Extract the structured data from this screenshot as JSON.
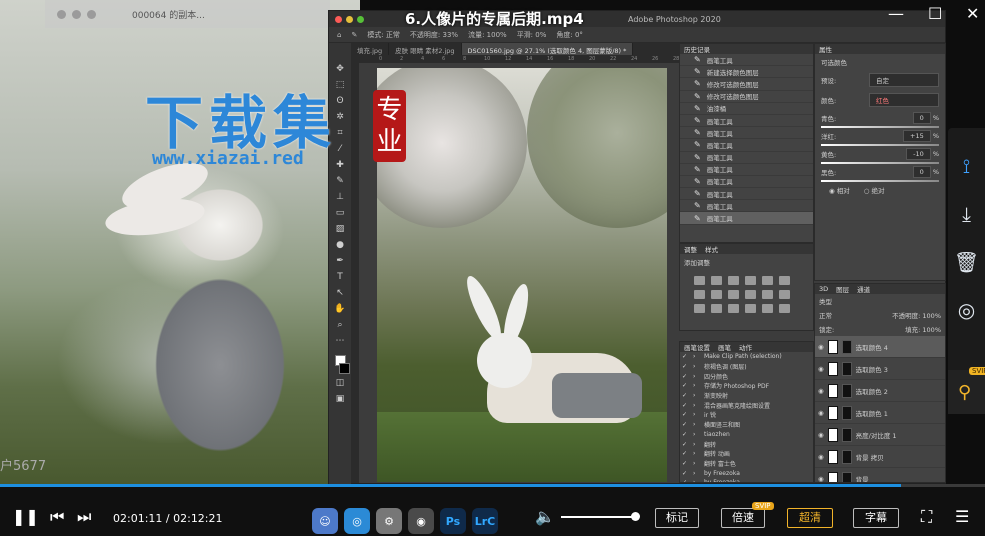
{
  "player": {
    "title": "6.人像片的专属后期.mp4",
    "current_time": "02:01:11",
    "total_time": "02:12:21",
    "time_sep": " / ",
    "progress": 0.915,
    "buttons": {
      "mark": "标记",
      "speed": "倍速",
      "quality": "超清",
      "subtitle": "字幕",
      "svip": "SVIP"
    },
    "top_controls": {
      "minimize": "—",
      "maximize": "☐",
      "close": "✕"
    }
  },
  "background_window": {
    "file_name": "000064 的副本..."
  },
  "watermark": {
    "title": "下载集",
    "url": "www.xiazai.red",
    "seal": [
      "专",
      "业"
    ]
  },
  "side_text": "户5677",
  "photoshop": {
    "app_title": "Adobe Photoshop 2020",
    "options_bar": [
      "模式: 正常",
      "不透明度: 33%",
      "流量: 100%",
      "平滑: 0%",
      "角度: 0°"
    ],
    "tabs": [
      "填充.jpg",
      "皮肤 眼睛 素材2.jpg",
      "DSC01560.jpg @ 27.1% (选取颜色 4, 图层蒙版/8) *"
    ],
    "active_tab": 2,
    "ruler_ticks": [
      "0",
      "2",
      "4",
      "6",
      "8",
      "10",
      "12",
      "14",
      "16",
      "18",
      "20",
      "22",
      "24",
      "26",
      "28"
    ],
    "history": {
      "tabs": [
        "历史记录"
      ],
      "items": [
        "画笔工具",
        "新建选择颜色图层",
        "修改可选颜色图层",
        "修改可选颜色图层",
        "油漆桶",
        "画笔工具",
        "画笔工具",
        "画笔工具",
        "画笔工具",
        "画笔工具",
        "画笔工具",
        "画笔工具",
        "画笔工具",
        "画笔工具"
      ],
      "selected": 13
    },
    "adjustments": {
      "tabs": [
        "调整",
        "样式"
      ],
      "title": "添加调整"
    },
    "actions": {
      "tabs": [
        "画笔设置",
        "画笔",
        "动作"
      ],
      "items": [
        "Make Clip Path (selection)",
        "棕褐色调 (图层)",
        "四分颜色",
        "存储为 Photoshop PDF",
        "渐变映射",
        "混合器画笔克隆绘图设置",
        "ir 锐",
        "横面竖三和图",
        "tiaozhen",
        "翻转",
        "翻转 动画",
        "翻转 富士色",
        "by Freezoka",
        "by Freezoka"
      ]
    },
    "properties": {
      "title": "属性",
      "subtitle": "可选颜色",
      "preset_label": "预设:",
      "preset": "自定",
      "colors_label": "颜色:",
      "color": "红色",
      "sliders": [
        {
          "name": "青色:",
          "value": "0",
          "unit": "%"
        },
        {
          "name": "洋红:",
          "value": "+15",
          "unit": "%"
        },
        {
          "name": "黄色:",
          "value": "-10",
          "unit": "%"
        },
        {
          "name": "黑色:",
          "value": "0",
          "unit": "%"
        }
      ],
      "mode_relative": "相对",
      "mode_absolute": "绝对"
    },
    "layers": {
      "tabs": [
        "3D",
        "图层",
        "通道"
      ],
      "kind": "类型",
      "blend": "正常",
      "opacity_label": "不透明度:",
      "opacity": "100%",
      "lock_label": "锁定:",
      "fill_label": "填充:",
      "fill": "100%",
      "items": [
        {
          "name": "选取颜色 4",
          "selected": true
        },
        {
          "name": "选取颜色 3",
          "selected": false
        },
        {
          "name": "选取颜色 2",
          "selected": false
        },
        {
          "name": "选取颜色 1",
          "selected": false
        },
        {
          "name": "亮度/对比度 1",
          "selected": false
        },
        {
          "name": "背景 拷贝",
          "selected": false
        },
        {
          "name": "背景",
          "selected": false
        }
      ]
    }
  },
  "dock_apps": [
    "Ps",
    "LrC"
  ],
  "colors": {
    "accent": "#1d8fe0",
    "gold": "#f2b42a",
    "watermark": "#2d87d8",
    "seal": "#b51818"
  }
}
